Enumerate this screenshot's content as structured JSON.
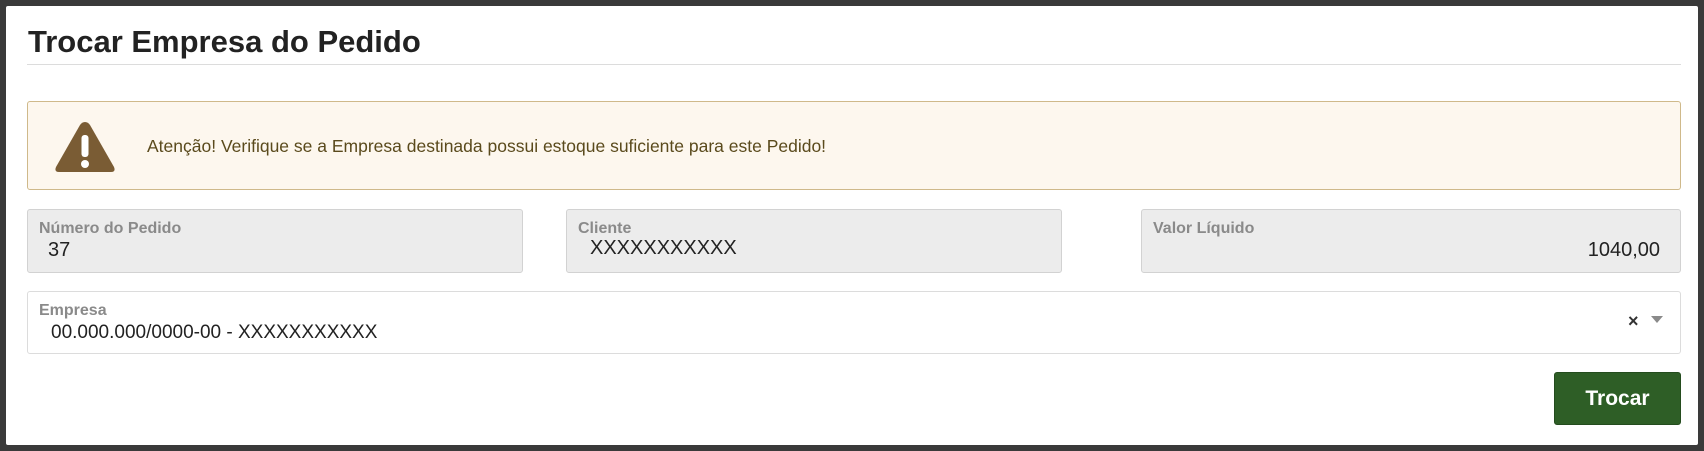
{
  "dialog": {
    "title": "Trocar Empresa do Pedido"
  },
  "alert": {
    "message": "Atenção! Verifique se a Empresa destinada possui estoque suficiente para este Pedido!",
    "icon": "warning-triangle-icon",
    "colors": {
      "background": "#fdf7ee",
      "border": "#cfb98a",
      "icon": "#7a5c34",
      "text": "#5a4a1c"
    }
  },
  "fields": {
    "numero_pedido": {
      "label": "Número do Pedido",
      "value": "37"
    },
    "cliente": {
      "label": "Cliente",
      "value": "XXXXXXXXXXX"
    },
    "valor_liquido": {
      "label": "Valor Líquido",
      "value": "1040,00"
    }
  },
  "empresa": {
    "label": "Empresa",
    "value": "00.000.000/0000-00 - XXXXXXXXXXX",
    "clear_symbol": "×"
  },
  "actions": {
    "trocar_label": "Trocar"
  },
  "colors": {
    "primary_button": "#2e5e26",
    "readonly_field_bg": "#ececec"
  }
}
